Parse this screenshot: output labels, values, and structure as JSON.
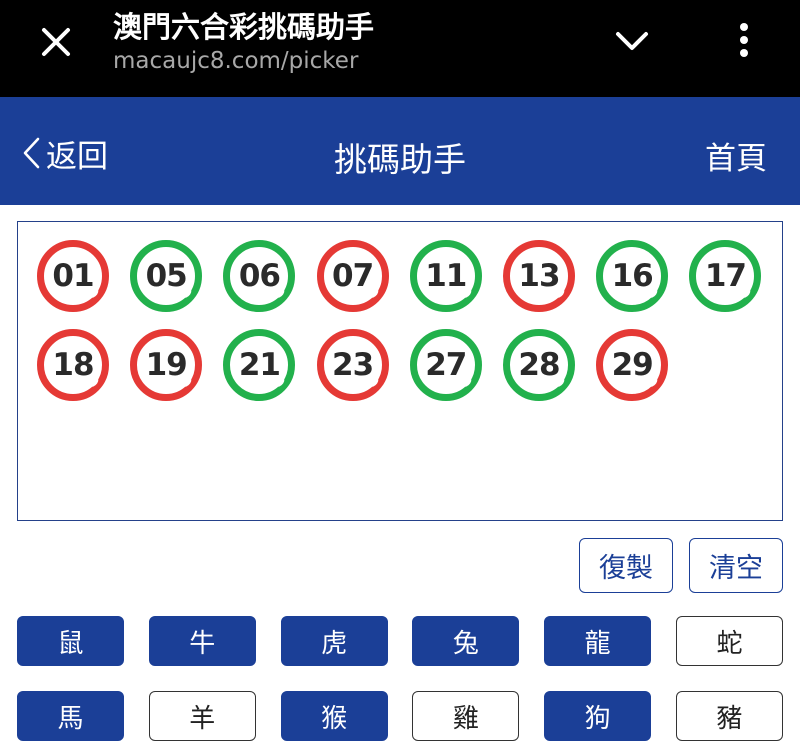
{
  "browser": {
    "title": "澳門六合彩挑碼助手",
    "url": "macaujc8.com/picker",
    "icons": [
      "close-icon",
      "chevron-down-icon",
      "more-vertical-icon"
    ]
  },
  "header": {
    "back_label": "返回",
    "title": "挑碼助手",
    "home_label": "首頁"
  },
  "colors": {
    "header_bg": "#1b3f97",
    "ball_red": "#e53935",
    "ball_green": "#22b14c"
  },
  "selected_numbers": [
    {
      "num": "01",
      "color": "red"
    },
    {
      "num": "05",
      "color": "green"
    },
    {
      "num": "06",
      "color": "green"
    },
    {
      "num": "07",
      "color": "red"
    },
    {
      "num": "11",
      "color": "green"
    },
    {
      "num": "13",
      "color": "red"
    },
    {
      "num": "16",
      "color": "green"
    },
    {
      "num": "17",
      "color": "green"
    },
    {
      "num": "18",
      "color": "red"
    },
    {
      "num": "19",
      "color": "red"
    },
    {
      "num": "21",
      "color": "green"
    },
    {
      "num": "23",
      "color": "red"
    },
    {
      "num": "27",
      "color": "green"
    },
    {
      "num": "28",
      "color": "green"
    },
    {
      "num": "29",
      "color": "red"
    }
  ],
  "actions": {
    "copy_label": "復製",
    "clear_label": "清空"
  },
  "zodiacs": [
    {
      "label": "鼠",
      "selected": true
    },
    {
      "label": "牛",
      "selected": true
    },
    {
      "label": "虎",
      "selected": true
    },
    {
      "label": "兔",
      "selected": true
    },
    {
      "label": "龍",
      "selected": true
    },
    {
      "label": "蛇",
      "selected": false
    },
    {
      "label": "馬",
      "selected": true
    },
    {
      "label": "羊",
      "selected": false
    },
    {
      "label": "猴",
      "selected": true
    },
    {
      "label": "雞",
      "selected": false
    },
    {
      "label": "狗",
      "selected": true
    },
    {
      "label": "豬",
      "selected": false
    }
  ]
}
